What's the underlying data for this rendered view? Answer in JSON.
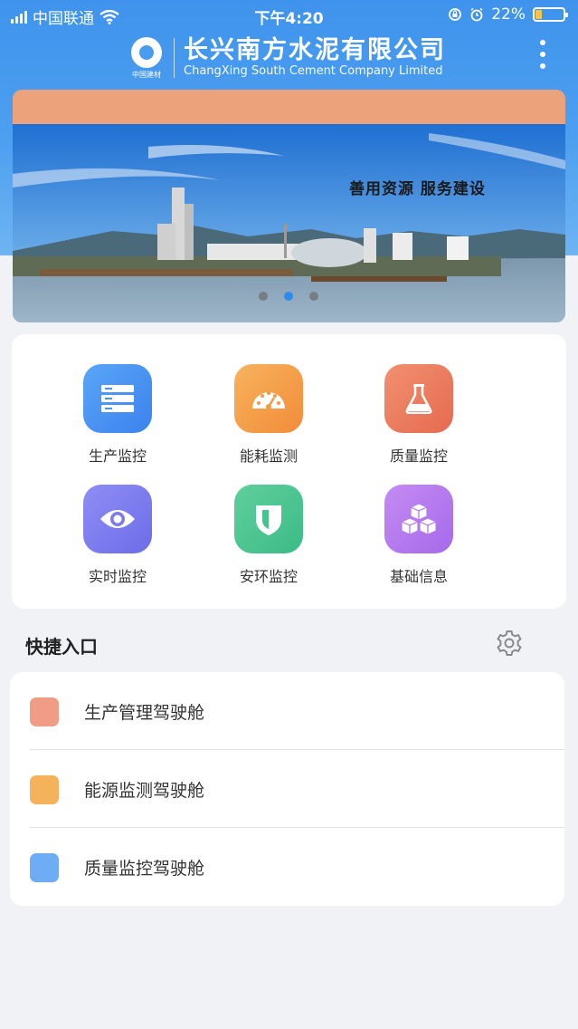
{
  "status_bar": {
    "carrier": "中国联通",
    "time": "下午4:20",
    "battery_percent": "22%",
    "battery_level": 0.22,
    "icons": [
      "signal-icon",
      "wifi-icon",
      "rotation-lock-icon",
      "alarm-icon",
      "battery-icon"
    ]
  },
  "header": {
    "logo_text": "中国建材",
    "company_cn": "长兴南方水泥有限公司",
    "company_en": "ChangXing South Cement Company Limited",
    "menu_icon": "more-vertical-icon"
  },
  "banner": {
    "slogan": "善用资源  服务建设",
    "slides": 3,
    "active_slide": 2
  },
  "functions": [
    {
      "label": "生产监控",
      "icon": "server-list-icon",
      "colors": [
        "#5aa6f7",
        "#3b82ee"
      ]
    },
    {
      "label": "能耗监测",
      "icon": "gauge-icon",
      "colors": [
        "#f7b35c",
        "#f28c3a"
      ]
    },
    {
      "label": "质量监控",
      "icon": "flask-icon",
      "colors": [
        "#f19070",
        "#e66a50"
      ]
    },
    {
      "label": "实时监控",
      "icon": "eye-icon",
      "colors": [
        "#8f8ef5",
        "#6d6ce8"
      ]
    },
    {
      "label": "安环监控",
      "icon": "shield-icon",
      "colors": [
        "#5fcf9d",
        "#3cbb86"
      ]
    },
    {
      "label": "基础信息",
      "icon": "cubes-icon",
      "colors": [
        "#c48bf3",
        "#a56ae9"
      ]
    }
  ],
  "quick_entry": {
    "title": "快捷入口",
    "settings_icon": "gear-icon",
    "items": [
      {
        "label": "生产管理驾驶舱",
        "color": "#f19c84"
      },
      {
        "label": "能源监测驾驶舱",
        "color": "#f4b25b"
      },
      {
        "label": "质量监控驾驶舱",
        "color": "#6eacf6"
      }
    ]
  }
}
